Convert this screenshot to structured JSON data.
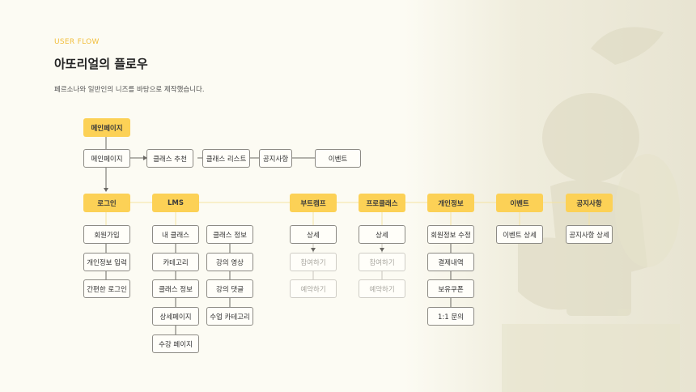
{
  "header": {
    "eyebrow": "USER FLOW",
    "title": "아또리얼의 플로우",
    "description": "페르소나와 일반인의 니즈를 바탕으로 제작했습니다."
  },
  "colors": {
    "accent": "#fcd156",
    "eyebrow": "#f2bf3d",
    "border": "#8c8a84",
    "disabled_border": "#cfcdc6",
    "disabled_text": "#a9a7a0",
    "line": "#f5e3a0"
  },
  "flow": {
    "main": "메인페이지",
    "top_row": [
      "메인페이지",
      "클래스 추천",
      "클래스 리스트",
      "공지사항",
      "이벤트"
    ],
    "categories": {
      "login": {
        "label": "로그인",
        "items": [
          "회원가입",
          "개인정보 입력",
          "간편한 로그인"
        ]
      },
      "lms": {
        "label": "LMS",
        "left_items": [
          "내 클래스",
          "카테고리",
          "클래스 정보",
          "상세페이지",
          "수강 페이지"
        ],
        "right_items": [
          "클래스 정보",
          "강의 영상",
          "강의 댓글",
          "수업 카테고리"
        ]
      },
      "bootcamp": {
        "label": "부트캠프",
        "items": [
          "상세",
          "참여하기",
          "예약하기"
        ]
      },
      "program": {
        "label": "프로클래스",
        "items": [
          "상세",
          "참여하기",
          "예약하기"
        ]
      },
      "profile": {
        "label": "개인정보",
        "items": [
          "회원정보 수정",
          "결제내역",
          "보유쿠폰",
          "1:1 문의"
        ]
      },
      "event": {
        "label": "이벤트",
        "items": [
          "이벤트 상세"
        ]
      },
      "notice": {
        "label": "공지사항",
        "items": [
          "공지사항 상세"
        ]
      }
    }
  }
}
